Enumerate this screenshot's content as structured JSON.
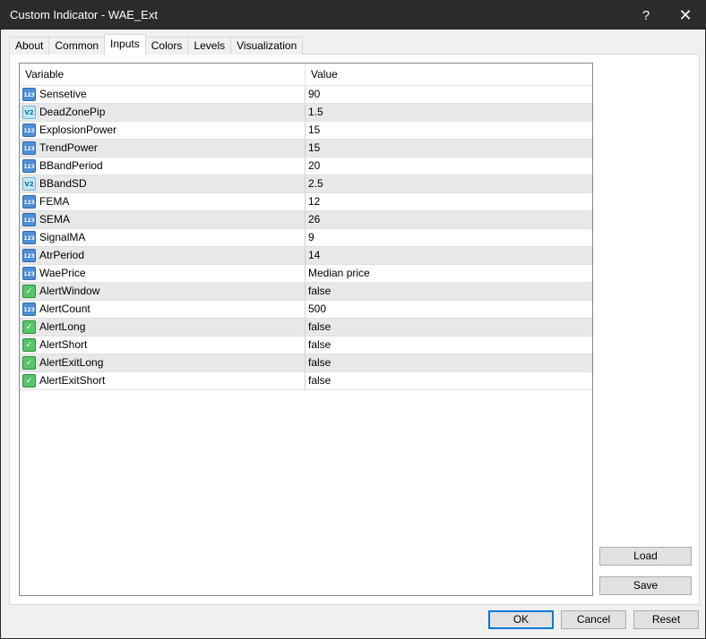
{
  "window": {
    "title": "Custom Indicator - WAE_Ext",
    "help_glyph": "?",
    "close_glyph": "✕"
  },
  "tabs": [
    {
      "label": "About"
    },
    {
      "label": "Common"
    },
    {
      "label": "Inputs",
      "active": true
    },
    {
      "label": "Colors"
    },
    {
      "label": "Levels"
    },
    {
      "label": "Visualization"
    }
  ],
  "grid": {
    "headers": {
      "variable": "Variable",
      "value": "Value"
    },
    "rows": [
      {
        "variable": "Sensetive",
        "value": "90",
        "type_icon": "int-icon",
        "icon_text": "123"
      },
      {
        "variable": "DeadZonePip",
        "value": "1.5",
        "type_icon": "double-icon",
        "icon_text": "V2"
      },
      {
        "variable": "ExplosionPower",
        "value": "15",
        "type_icon": "int-icon",
        "icon_text": "123"
      },
      {
        "variable": "TrendPower",
        "value": "15",
        "type_icon": "int-icon",
        "icon_text": "123"
      },
      {
        "variable": "BBandPeriod",
        "value": "20",
        "type_icon": "int-icon",
        "icon_text": "123"
      },
      {
        "variable": "BBandSD",
        "value": "2.5",
        "type_icon": "double-icon",
        "icon_text": "V2"
      },
      {
        "variable": "FEMA",
        "value": "12",
        "type_icon": "int-icon",
        "icon_text": "123"
      },
      {
        "variable": "SEMA",
        "value": "26",
        "type_icon": "int-icon",
        "icon_text": "123"
      },
      {
        "variable": "SignalMA",
        "value": "9",
        "type_icon": "int-icon",
        "icon_text": "123"
      },
      {
        "variable": "AtrPeriod",
        "value": "14",
        "type_icon": "int-icon",
        "icon_text": "123"
      },
      {
        "variable": "WaePrice",
        "value": "Median price",
        "type_icon": "int-icon",
        "icon_text": "123"
      },
      {
        "variable": "AlertWindow",
        "value": "false",
        "type_icon": "bool-icon",
        "icon_text": "✓"
      },
      {
        "variable": "AlertCount",
        "value": "500",
        "type_icon": "int-icon",
        "icon_text": "123"
      },
      {
        "variable": "AlertLong",
        "value": "false",
        "type_icon": "bool-icon",
        "icon_text": "✓"
      },
      {
        "variable": "AlertShort",
        "value": "false",
        "type_icon": "bool-icon",
        "icon_text": "✓"
      },
      {
        "variable": "AlertExitLong",
        "value": "false",
        "type_icon": "bool-icon",
        "icon_text": "✓"
      },
      {
        "variable": "AlertExitShort",
        "value": "false",
        "type_icon": "bool-icon",
        "icon_text": "✓"
      }
    ]
  },
  "buttons": {
    "load": "Load",
    "save": "Save",
    "ok": "OK",
    "cancel": "Cancel",
    "reset": "Reset"
  },
  "colors": {
    "titlebar": "#2b2b2b",
    "focus_border": "#0078d7",
    "row_alt": "#e8e8e8"
  }
}
